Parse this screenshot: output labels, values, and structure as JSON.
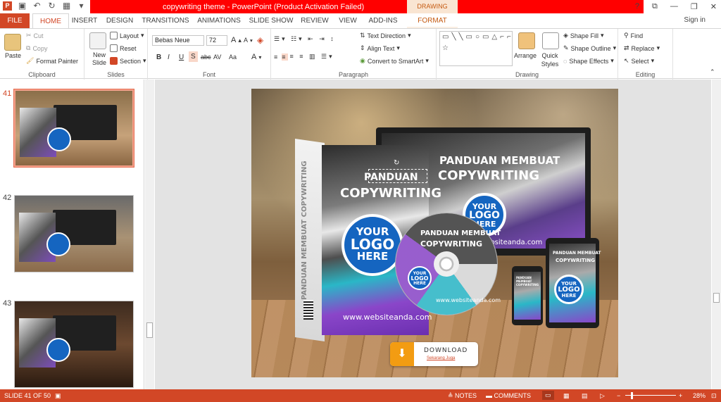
{
  "window": {
    "title": "copywriting theme -  PowerPoint (Product Activation Failed)",
    "contextual_tab": "DRAWING TOOLS",
    "controls": [
      "?",
      "⧉",
      "—",
      "❐",
      "✕"
    ]
  },
  "tabs": {
    "file": "FILE",
    "items": [
      "HOME",
      "INSERT",
      "DESIGN",
      "TRANSITIONS",
      "ANIMATIONS",
      "SLIDE SHOW",
      "REVIEW",
      "VIEW",
      "ADD-INS",
      "FORMAT"
    ],
    "active": "HOME",
    "signin": "Sign in"
  },
  "ribbon": {
    "clipboard": {
      "paste": "Paste",
      "cut": "Cut",
      "copy": "Copy",
      "format_painter": "Format Painter",
      "label": "Clipboard"
    },
    "slides": {
      "new_slide": "New Slide",
      "layout": "Layout",
      "reset": "Reset",
      "section": "Section",
      "label": "Slides"
    },
    "font": {
      "font_name": "Bebas Neue",
      "font_size": "72",
      "bold": "B",
      "italic": "I",
      "underline": "U",
      "shadow": "S",
      "strike": "abc",
      "spacing": "AV",
      "case": "Aa",
      "label": "Font"
    },
    "paragraph": {
      "text_direction": "Text Direction",
      "align_text": "Align Text",
      "convert_smartart": "Convert to SmartArt",
      "label": "Paragraph"
    },
    "drawing": {
      "arrange": "Arrange",
      "quick_styles": "Quick Styles",
      "shape_fill": "Shape Fill",
      "shape_outline": "Shape Outline",
      "shape_effects": "Shape Effects",
      "label": "Drawing"
    },
    "editing": {
      "find": "Find",
      "replace": "Replace",
      "select": "Select",
      "label": "Editing"
    }
  },
  "thumbnails": [
    {
      "number": "41",
      "selected": true
    },
    {
      "number": "42",
      "selected": false
    },
    {
      "number": "43",
      "selected": false
    }
  ],
  "slide": {
    "box_title_1": "PANDUAN",
    "box_title_2": "COPYWRITING",
    "box_side": "PANDUAN MEMBUAT COPYWRITING",
    "box_url": "www.websiteanda.com",
    "monitor_title_1": "PANDUAN MEMBUAT",
    "monitor_title_2": "COPYWRITING",
    "monitor_url": "websiteanda.com",
    "disc_title_1": "PANDUAN MEMBUAT",
    "disc_title_2": "COPYWRITING",
    "disc_url": "www.websiteanda.com",
    "logo_1": "YOUR",
    "logo_2": "LOGO",
    "logo_3": "HERE",
    "tablet_title_1": "PANDUAN MEMBUAT",
    "tablet_title_2": "COPYWRITING",
    "phone_title": "PANDUAN MEMBUAT COPYWRITING",
    "download_label": "DOWNLOAD",
    "download_sub": "Sekarang Juga"
  },
  "status": {
    "slide_of": "SLIDE 41 OF 50",
    "notes": "NOTES",
    "comments": "COMMENTS",
    "zoom": "28%"
  },
  "colors": {
    "accent": "#d24726",
    "titlebar_red": "#ff0000",
    "logo_blue": "#1565c0"
  }
}
